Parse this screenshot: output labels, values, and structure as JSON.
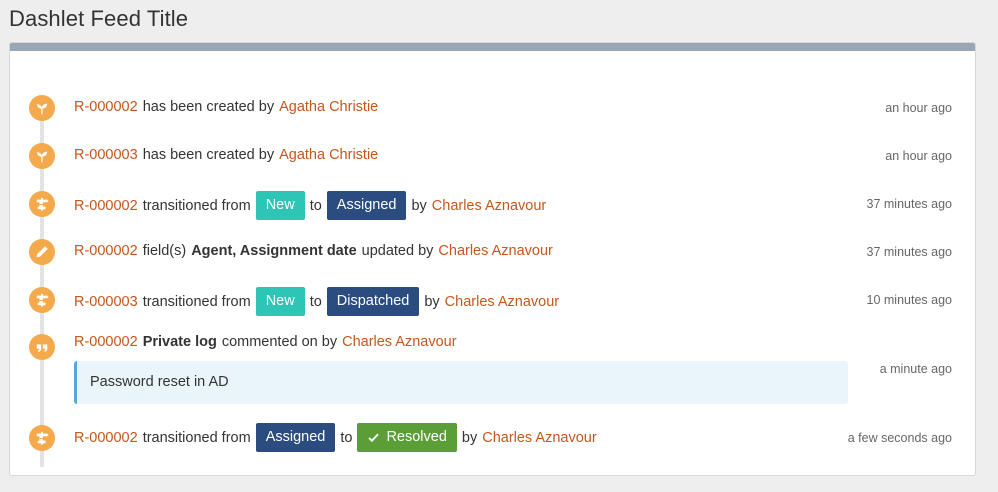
{
  "dashlet": {
    "title": "Dashlet Feed Title"
  },
  "entries": [
    {
      "icon": "sprout-icon",
      "ref": "R-000002",
      "text": "has been created by",
      "user": "Agatha Christie",
      "time": "an hour ago"
    },
    {
      "icon": "sprout-icon",
      "ref": "R-000003",
      "text": "has been created by",
      "user": "Agatha Christie",
      "time": "an hour ago"
    },
    {
      "icon": "signpost-icon",
      "ref": "R-000002",
      "text": "transitioned from",
      "from": "New",
      "to_word": "to",
      "to": "Assigned",
      "by": "by",
      "user": "Charles Aznavour",
      "time": "37 minutes ago"
    },
    {
      "icon": "pencil-icon",
      "ref": "R-000002",
      "text": "field(s)",
      "fields": "Agent, Assignment date",
      "text2": "updated by",
      "user": "Charles Aznavour",
      "time": "37 minutes ago"
    },
    {
      "icon": "signpost-icon",
      "ref": "R-000003",
      "text": "transitioned from",
      "from": "New",
      "to_word": "to",
      "to": "Dispatched",
      "by": "by",
      "user": "Charles Aznavour",
      "time": "10 minutes ago"
    },
    {
      "icon": "quote-icon",
      "ref": "R-000002",
      "log": "Private log",
      "text": "commented on by",
      "user": "Charles Aznavour",
      "comment": "Password reset in AD",
      "time": "a minute ago"
    },
    {
      "icon": "signpost-icon",
      "ref": "R-000002",
      "text": "transitioned from",
      "from": "Assigned",
      "to_word": "to",
      "to": "Resolved",
      "by": "by",
      "user": "Charles Aznavour",
      "time": "a few seconds ago"
    }
  ],
  "colors": {
    "icon_bg": "#f5a94d",
    "link": "#c4571d",
    "badge_new": "#2ec4b6",
    "badge_assigned": "#2b4c7e",
    "badge_resolved": "#5a9e35",
    "panel_header": "#9aa6b3"
  }
}
